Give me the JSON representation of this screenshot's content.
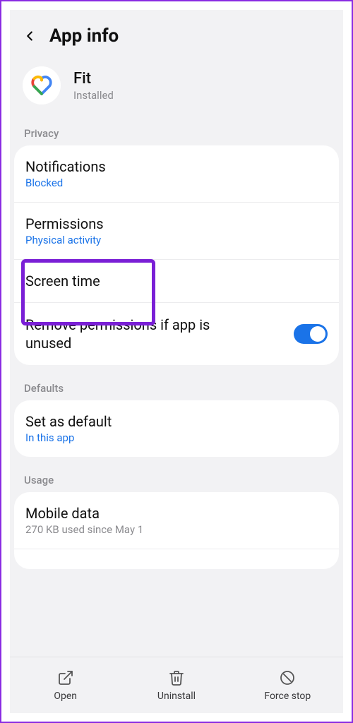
{
  "header": {
    "title": "App info"
  },
  "app": {
    "name": "Fit",
    "status": "Installed"
  },
  "sections": {
    "privacy": {
      "label": "Privacy",
      "notifications": {
        "title": "Notifications",
        "sub": "Blocked"
      },
      "permissions": {
        "title": "Permissions",
        "sub": "Physical activity"
      },
      "screentime": {
        "title": "Screen time"
      },
      "remove": {
        "title": "Remove permissions if app is unused",
        "toggled": true
      }
    },
    "defaults": {
      "label": "Defaults",
      "setdefault": {
        "title": "Set as default",
        "sub": "In this app"
      }
    },
    "usage": {
      "label": "Usage",
      "mobile": {
        "title": "Mobile data",
        "sub": "270 KB used since May 1"
      }
    }
  },
  "bottombar": {
    "open": "Open",
    "uninstall": "Uninstall",
    "forcestop": "Force stop"
  }
}
